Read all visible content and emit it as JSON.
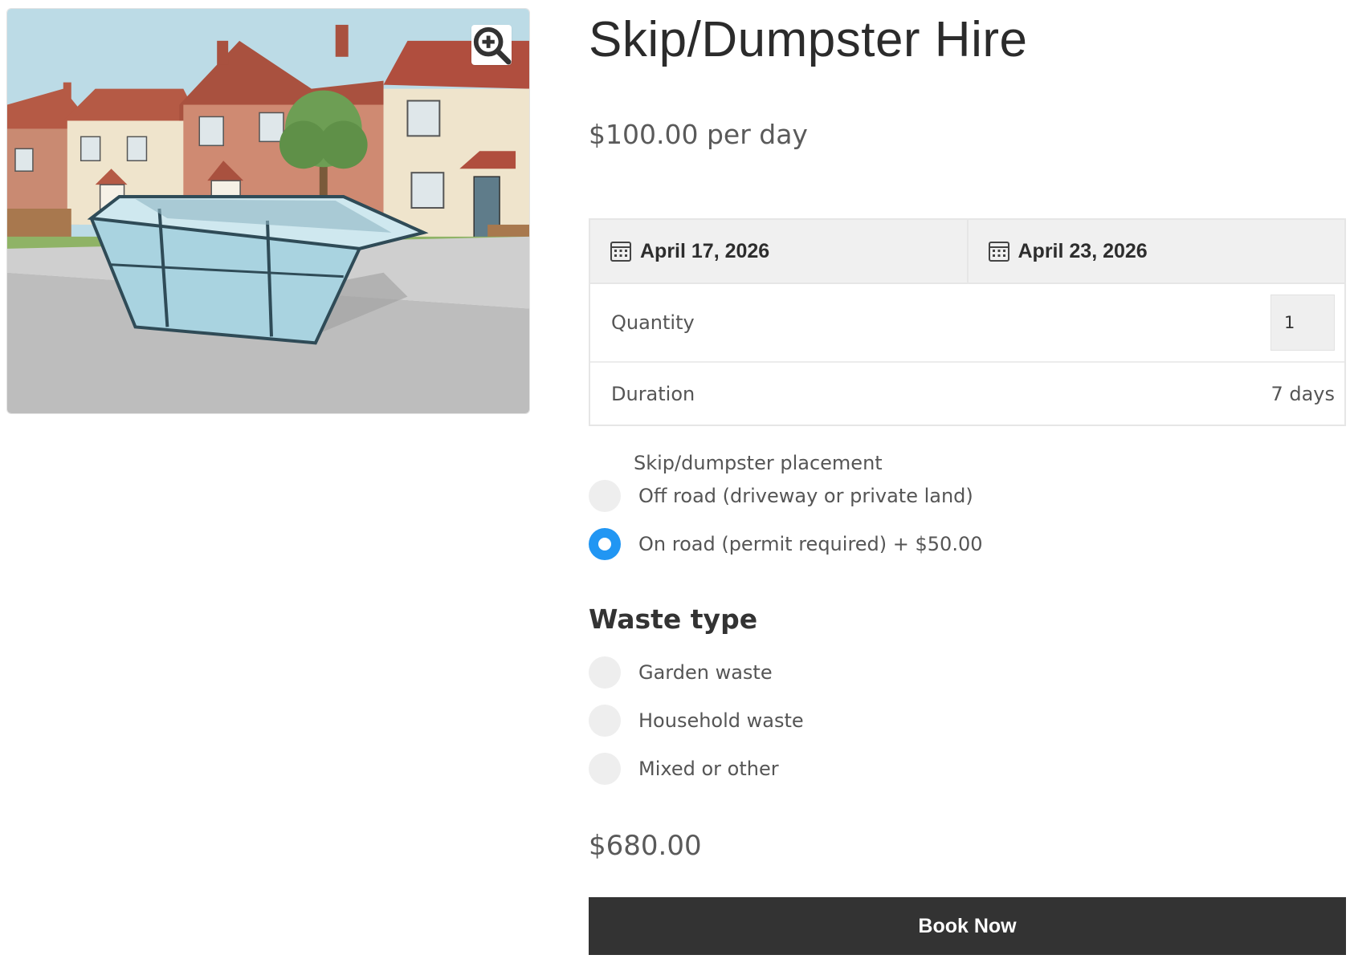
{
  "product": {
    "title": "Skip/Dumpster Hire",
    "price": "$100.00 per day",
    "image_alt_icon": "zoom-in-icon"
  },
  "booking": {
    "start_date": "April 17, 2026",
    "end_date": "April 23, 2026",
    "date_icon": "calendar-icon",
    "quantity_label": "Quantity",
    "quantity_value": "1",
    "duration_label": "Duration",
    "duration_value": "7 days"
  },
  "placement": {
    "label": "Skip/dumpster placement",
    "options": [
      {
        "label": "Off road (driveway or private land)",
        "selected": false
      },
      {
        "label": "On road (permit required) + $50.00",
        "selected": true
      }
    ]
  },
  "waste": {
    "heading": "Waste type",
    "options": [
      {
        "label": "Garden waste",
        "selected": false
      },
      {
        "label": "Household waste",
        "selected": false
      },
      {
        "label": "Mixed or other",
        "selected": false
      }
    ]
  },
  "total": "$680.00",
  "book_button": "Book Now",
  "colors": {
    "accent": "#2196f3",
    "button": "#333333",
    "date_bar": "#f0f0f0"
  }
}
